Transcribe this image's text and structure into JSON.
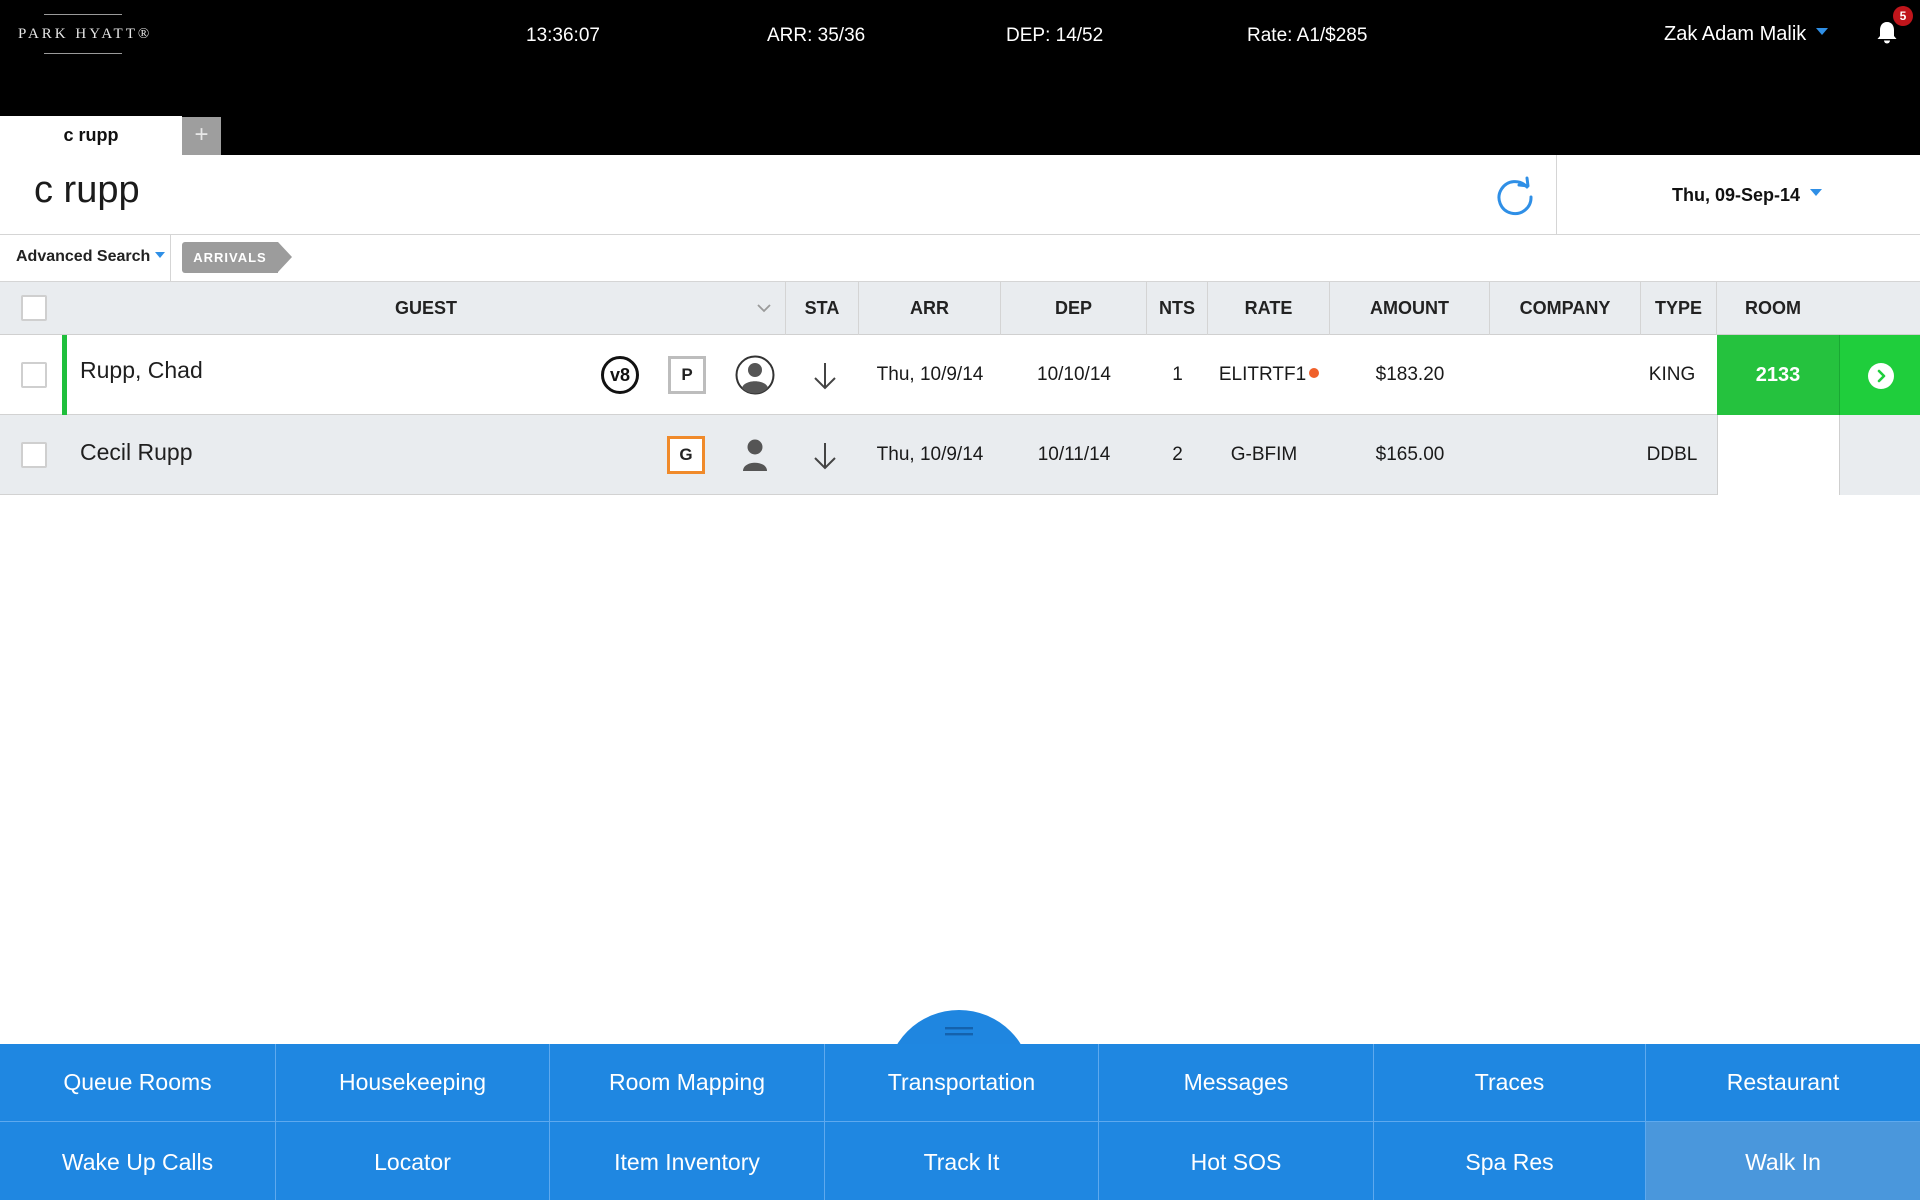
{
  "header": {
    "logo_text": "PARK HYATT®",
    "clock": "13:36:07",
    "arrivals": "ARR: 35/36",
    "departures": "DEP: 14/52",
    "rate": "Rate: A1/$285",
    "user_name": "Zak Adam Malik",
    "notification_count": "5"
  },
  "tabs": {
    "active_label": "c rupp",
    "add_label": "+"
  },
  "search": {
    "title": "c rupp",
    "date": "Thu, 09-Sep-14"
  },
  "filters": {
    "advanced_search_label": "Advanced Search",
    "chip_label": "ARRIVALS"
  },
  "table": {
    "columns": {
      "guest": "GUEST",
      "sta": "STA",
      "arr": "ARR",
      "dep": "DEP",
      "nts": "NTS",
      "rate": "RATE",
      "amount": "AMOUNT",
      "company": "COMPANY",
      "type": "TYPE",
      "room": "ROOM"
    },
    "rows": [
      {
        "guest": "Rupp, Chad",
        "badge1": "v8",
        "badge2": "P",
        "status_icon": "arrow-down-icon",
        "arr": "Thu, 10/9/14",
        "dep": "10/10/14",
        "nts": "1",
        "rate": "ELITRTF1",
        "amount": "$183.20",
        "company": "",
        "type": "KING",
        "room": "2133",
        "accent_color": "#1fbf3c"
      },
      {
        "guest": "Cecil Rupp",
        "badge1": "G",
        "status_icon": "arrow-down-icon",
        "arr": "Thu, 10/9/14",
        "dep": "10/11/14",
        "nts": "2",
        "rate": "G-BFIM",
        "amount": "$165.00",
        "company": "",
        "type": "DDBL",
        "room": ""
      }
    ]
  },
  "actions": {
    "row1": [
      "Queue Rooms",
      "Housekeeping",
      "Room Mapping",
      "Transportation",
      "Messages",
      "Traces",
      "Restaurant"
    ],
    "row2": [
      "Wake Up Calls",
      "Locator",
      "Item Inventory",
      "Track It",
      "Hot SOS",
      "Spa Res",
      "Walk In"
    ]
  },
  "colors": {
    "accent_blue": "#1f87e1",
    "room_green": "#25c23e",
    "alert_orange": "#f08a2a",
    "badge_red": "#c0151b"
  }
}
